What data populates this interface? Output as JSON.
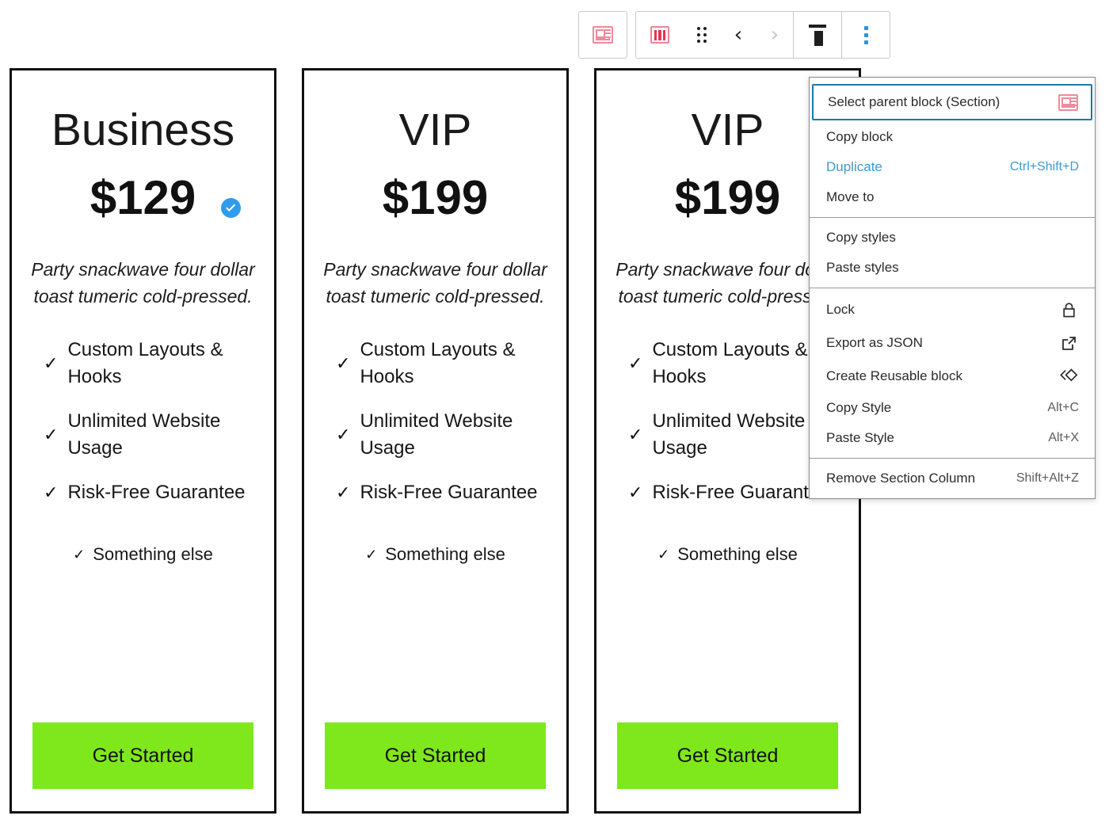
{
  "toolbar": {
    "parent_block_button": {
      "name": "select-parent-section-icon",
      "title": "Select parent block (Section)"
    },
    "block_type_button": {
      "name": "section-column-icon",
      "title": "Section Column"
    },
    "drag_handle": {
      "name": "drag-handle-icon",
      "title": "Drag"
    },
    "move_up": {
      "name": "move-left-icon",
      "title": "Move left",
      "glyph": "‹"
    },
    "move_down": {
      "name": "move-right-icon",
      "title": "Move right",
      "glyph": "›"
    },
    "align_button": {
      "name": "align-top-icon",
      "title": "Change vertical alignment"
    },
    "more_options": {
      "name": "more-options-icon",
      "title": "Options"
    }
  },
  "cards": [
    {
      "title": "Business",
      "price": "$129",
      "selected": true,
      "description": "Party snackwave four dollar toast tumeric cold-pressed.",
      "features": [
        "Custom Layouts & Hooks",
        "Unlimited Website Usage",
        "Risk-Free Guarantee"
      ],
      "extra_feature": "Something else",
      "cta": "Get Started"
    },
    {
      "title": "VIP",
      "price": "$199",
      "selected": false,
      "description": "Party snackwave four dollar toast tumeric cold-pressed.",
      "features": [
        "Custom Layouts & Hooks",
        "Unlimited Website Usage",
        "Risk-Free Guarantee"
      ],
      "extra_feature": "Something else",
      "cta": "Get Started"
    },
    {
      "title": "VIP",
      "price": "$199",
      "selected": false,
      "description": "Party snackwave four dollar toast tumeric cold-pressed.",
      "features": [
        "Custom Layouts & Hooks",
        "Unlimited Website Usage",
        "Risk-Free Guarantee"
      ],
      "extra_feature": "Something else",
      "cta": "Get Started"
    }
  ],
  "menu": {
    "groups": [
      {
        "items": [
          {
            "label": "Select parent block (Section)",
            "shortcut": "",
            "icon": "section-icon",
            "state": "focused"
          },
          {
            "label": "Copy block",
            "shortcut": "",
            "icon": "",
            "state": "normal"
          },
          {
            "label": "Duplicate",
            "shortcut": "Ctrl+Shift+D",
            "icon": "",
            "state": "highlight"
          },
          {
            "label": "Move to",
            "shortcut": "",
            "icon": "",
            "state": "normal"
          }
        ]
      },
      {
        "items": [
          {
            "label": "Copy styles",
            "shortcut": "",
            "icon": "",
            "state": "normal"
          },
          {
            "label": "Paste styles",
            "shortcut": "",
            "icon": "",
            "state": "normal"
          }
        ]
      },
      {
        "items": [
          {
            "label": "Lock",
            "shortcut": "",
            "icon": "lock-icon",
            "state": "normal"
          },
          {
            "label": "Export as JSON",
            "shortcut": "",
            "icon": "external-link-icon",
            "state": "normal"
          },
          {
            "label": "Create Reusable block",
            "shortcut": "",
            "icon": "reusable-block-icon",
            "state": "normal"
          },
          {
            "label": "Copy Style",
            "shortcut": "Alt+C",
            "icon": "",
            "state": "normal"
          },
          {
            "label": "Paste Style",
            "shortcut": "Alt+X",
            "icon": "",
            "state": "normal"
          }
        ]
      },
      {
        "items": [
          {
            "label": "Remove Section Column",
            "shortcut": "Shift+Alt+Z",
            "icon": "",
            "state": "normal"
          }
        ]
      }
    ]
  },
  "colors": {
    "cta_green": "#7fe81c",
    "accent_blue": "#2d9cee",
    "menu_highlight": "#3e9bd0",
    "focus_ring": "#1b7aa8",
    "icon_pink": "#ef8498"
  }
}
